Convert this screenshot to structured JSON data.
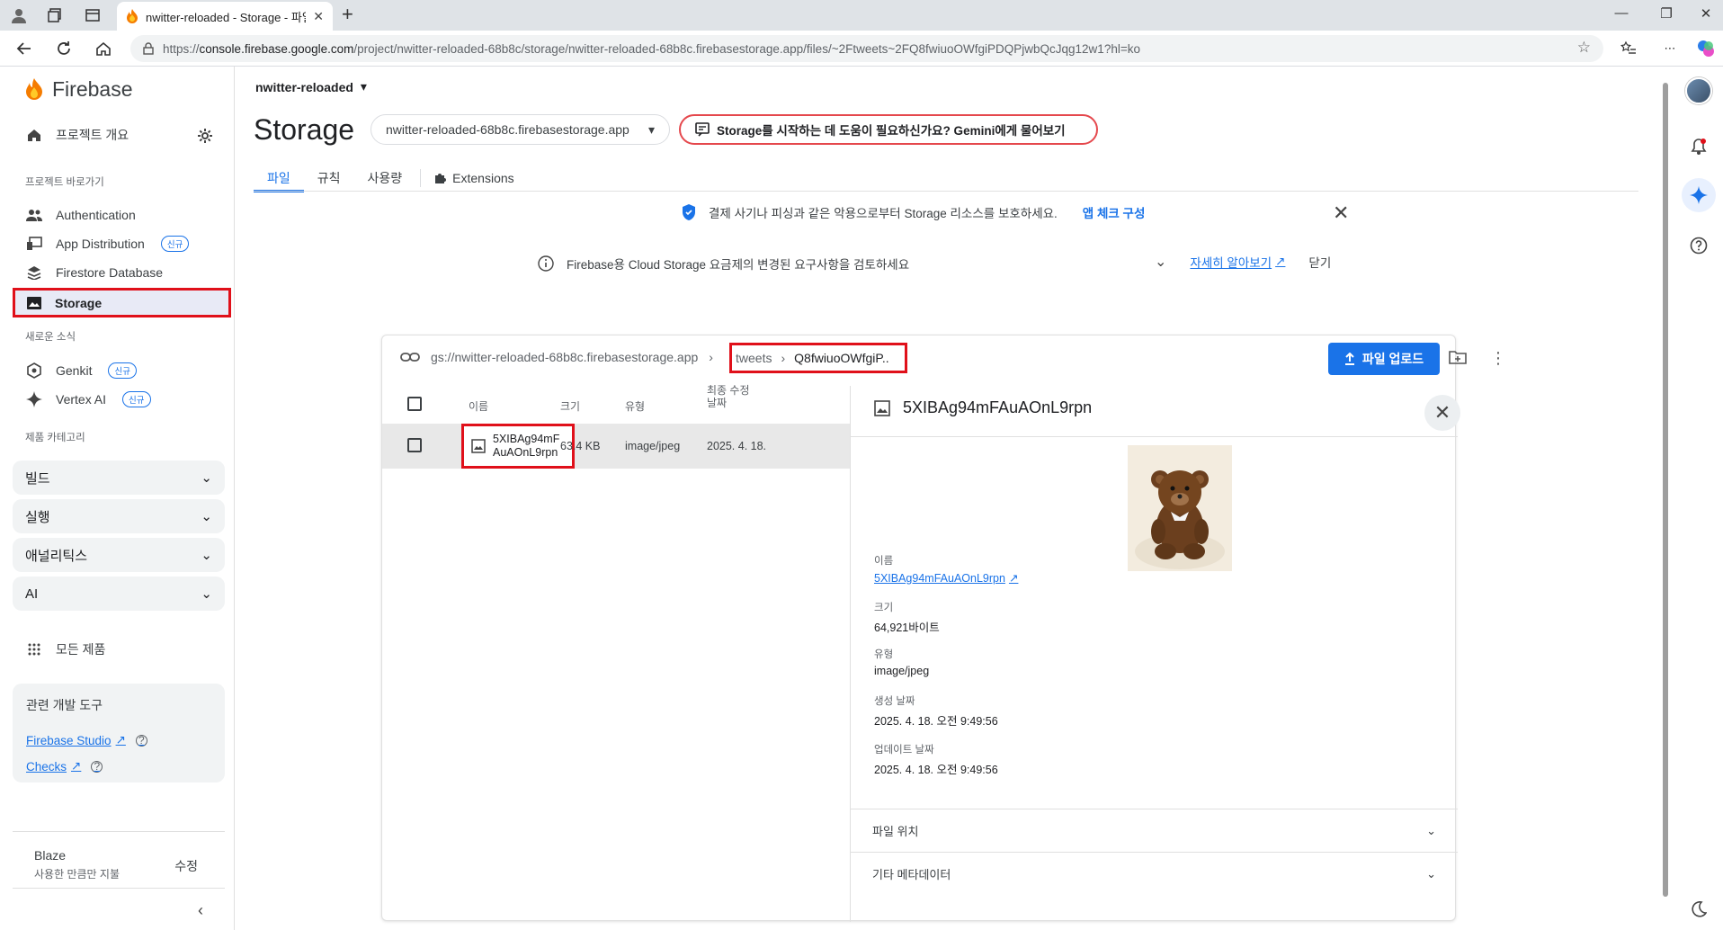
{
  "browser": {
    "tab_title": "nwitter-reloaded - Storage - 파일",
    "url_prefix": "https://",
    "url_host": "console.firebase.google.com",
    "url_path": "/project/nwitter-reloaded-68b8c/storage/nwitter-reloaded-68b8c.firebasestorage.app/files/~2Ftweets~2FQ8fwiuoOWfgiPDQPjwbQcJqg12w1?hl=ko"
  },
  "sidebar": {
    "brand": "Firebase",
    "overview": "프로젝트 개요",
    "shortcuts_title": "프로젝트 바로가기",
    "shortcuts": [
      {
        "label": "Authentication",
        "badge": ""
      },
      {
        "label": "App Distribution",
        "badge": "신규"
      },
      {
        "label": "Firestore Database",
        "badge": ""
      },
      {
        "label": "Storage",
        "badge": ""
      }
    ],
    "news_title": "새로운 소식",
    "news": [
      {
        "label": "Genkit",
        "badge": "신규"
      },
      {
        "label": "Vertex AI",
        "badge": "신규"
      }
    ],
    "categories_title": "제품 카테고리",
    "categories": [
      "빌드",
      "실행",
      "애널리틱스",
      "AI"
    ],
    "all_products": "모든 제품",
    "devtools_title": "관련 개발 도구",
    "devtools": [
      "Firebase Studio",
      "Checks"
    ],
    "plan_name": "Blaze",
    "plan_desc": "사용한 만큼만 지불",
    "plan_edit": "수정"
  },
  "header": {
    "project": "nwitter-reloaded",
    "title": "Storage",
    "bucket": "nwitter-reloaded-68b8c.firebasestorage.app",
    "gemini": "Storage를 시작하는 데 도움이 필요하신가요? Gemini에게 물어보기",
    "tabs": [
      "파일",
      "규칙",
      "사용량",
      "Extensions"
    ]
  },
  "banners": {
    "appcheck_text": "결제 사기나 피싱과 같은 악용으로부터 Storage 리소스를 보호하세요.",
    "appcheck_link": "앱 체크 구성",
    "pricing_text": "Firebase용 Cloud Storage 요금제의 변경된 요구사항을 검토하세요",
    "pricing_link": "자세히 알아보기",
    "pricing_close": "닫기"
  },
  "files": {
    "bucket_path": "gs://nwitter-reloaded-68b8c.firebasestorage.app",
    "crumb_folder": "tweets",
    "crumb_sub": "Q8fwiuoOWfgiP..",
    "upload": "파일 업로드",
    "columns": {
      "name": "이름",
      "size": "크기",
      "type": "유형",
      "modified": "최종 수정 날짜"
    },
    "rows": [
      {
        "name": "5XIBAg94mFAuAOnL9rpn",
        "size": "63.4 KB",
        "type": "image/jpeg",
        "modified": "2025. 4. 18."
      }
    ]
  },
  "detail": {
    "title": "5XIBAg94mFAuAOnL9rpn",
    "name_label": "이름",
    "name_value": "5XIBAg94mFAuAOnL9rpn",
    "size_label": "크기",
    "size_value": "64,921바이트",
    "type_label": "유형",
    "type_value": "image/jpeg",
    "created_label": "생성 날짜",
    "created_value": "2025. 4. 18. 오전 9:49:56",
    "updated_label": "업데이트 날짜",
    "updated_value": "2025. 4. 18. 오전 9:49:56",
    "acc_location": "파일 위치",
    "acc_meta": "기타 메타데이터"
  },
  "colors": {
    "accent": "#1a73e8",
    "highlight": "#e0101a"
  }
}
